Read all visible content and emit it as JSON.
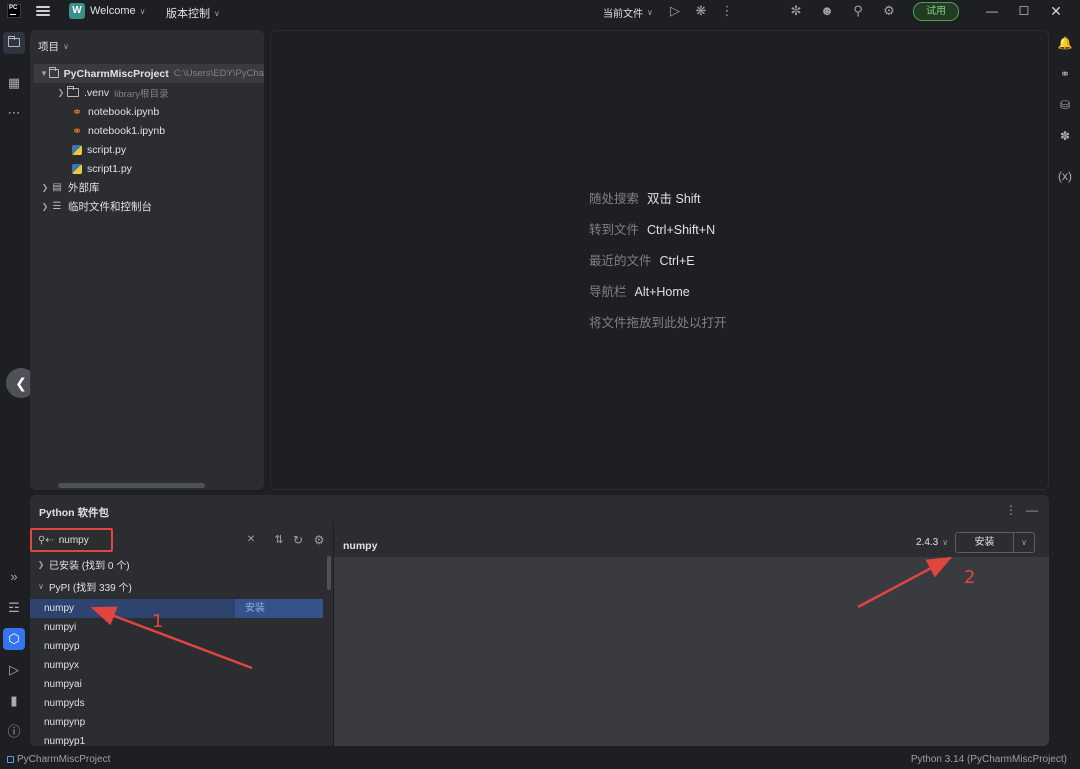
{
  "titlebar": {
    "logo_text": "PC",
    "project_badge": "W",
    "project_name": "Welcome",
    "vcs": "版本控制",
    "run_config": "当前文件",
    "trial": "试用"
  },
  "project_panel": {
    "title": "项目",
    "tree": [
      {
        "label": "PyCharmMiscProject",
        "extra": "C:\\Users\\EDY\\PyCha",
        "icon": "folder-icon"
      },
      {
        "label": ".venv",
        "extra": "library根目录",
        "icon": "folder-icon"
      },
      {
        "label": "notebook.ipynb",
        "icon": "notebook-icon"
      },
      {
        "label": "notebook1.ipynb",
        "icon": "notebook-icon"
      },
      {
        "label": "script.py",
        "icon": "python-file-icon"
      },
      {
        "label": "script1.py",
        "icon": "python-file-icon"
      },
      {
        "label": "外部库",
        "icon": "library-icon"
      },
      {
        "label": "临时文件和控制台",
        "icon": "scratch-icon"
      }
    ]
  },
  "editor_hints": [
    {
      "label": "随处搜索",
      "key": "双击 Shift"
    },
    {
      "label": "转到文件",
      "key": "Ctrl+Shift+N"
    },
    {
      "label": "最近的文件",
      "key": "Ctrl+E"
    },
    {
      "label": "导航栏",
      "key": "Alt+Home"
    },
    {
      "label": "将文件拖放到此处以打开",
      "key": ""
    }
  ],
  "packages": {
    "title": "Python 软件包",
    "search_value": "numpy",
    "installed_group": "已安装 (找到 0 个)",
    "pypi_group": "PyPI (找到 339 个)",
    "results": [
      "numpy",
      "numpyi",
      "numpyp",
      "numpyx",
      "numpyai",
      "numpyds",
      "numpynp",
      "numpyp1"
    ],
    "row_install": "安装",
    "detail_title": "numpy",
    "version": "2.4.3",
    "install_button": "安装"
  },
  "annotations": {
    "one": "1",
    "two": "2"
  },
  "statusbar": {
    "project": "PyCharmMiscProject",
    "interpreter": "Python 3.14 (PyCharmMiscProject)"
  },
  "colors": {
    "accent": "#3574f0",
    "annotation": "#e0453f",
    "trial": "#4f9e4f"
  }
}
